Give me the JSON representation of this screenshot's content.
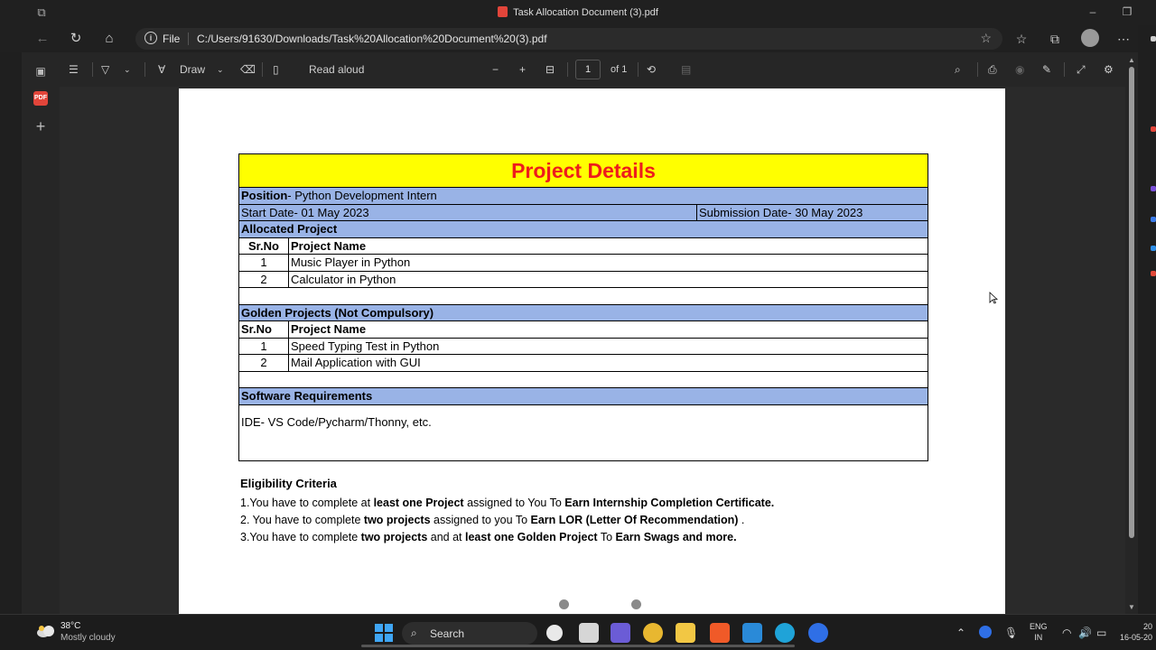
{
  "window": {
    "title": "Task Allocation Document (3).pdf"
  },
  "address_bar": {
    "scheme_label": "File",
    "url": "C:/Users/91630/Downloads/Task%20Allocation%20Document%20(3).pdf"
  },
  "pdf_toolbar": {
    "draw_label": "Draw",
    "read_aloud_label": "Read aloud",
    "page_number": "1",
    "page_total": "of 1"
  },
  "document": {
    "title": "Project Details",
    "position_label": "Position",
    "position_value": "- Python Development Intern",
    "start_date": "Start Date- 01 May 2023",
    "submission_date": "Submission Date- 30 May 2023",
    "allocated_header": "Allocated Project",
    "col_srno": "Sr.No",
    "col_project_name": "Project Name",
    "allocated_projects": [
      {
        "no": "1",
        "name": "Music Player in Python"
      },
      {
        "no": "2",
        "name": "Calculator in Python"
      }
    ],
    "golden_header": "Golden Projects (Not Compulsory)",
    "golden_projects": [
      {
        "no": "1",
        "name": "Speed Typing Test in Python"
      },
      {
        "no": "2",
        "name": "Mail Application with GUI"
      }
    ],
    "software_header": "Software Requirements",
    "software_text": "IDE- VS Code/Pycharm/Thonny, etc.",
    "eligibility": {
      "heading": "Eligibility Criteria",
      "line1": [
        "1.You have to complete at ",
        "least one Project",
        " assigned to You To ",
        "Earn Internship Completion Certificate."
      ],
      "line2": [
        "2. You have to complete ",
        "two projects",
        " assigned to you To ",
        "Earn LOR (Letter Of Recommendation)",
        " ."
      ],
      "line3": [
        "3.You have to complete ",
        "two projects",
        " and at ",
        "least one Golden Project",
        " To ",
        "Earn Swags and more."
      ]
    }
  },
  "taskbar": {
    "weather_temp": "38°C",
    "weather_desc": "Mostly cloudy",
    "search_label": "Search",
    "lang_line1": "ENG",
    "lang_line2": "IN",
    "time": "20",
    "date": "16-05-20"
  },
  "colors": {
    "title_bg": "#ffff00",
    "title_text": "#ee1c1c",
    "section_blue": "#99b3e6"
  }
}
